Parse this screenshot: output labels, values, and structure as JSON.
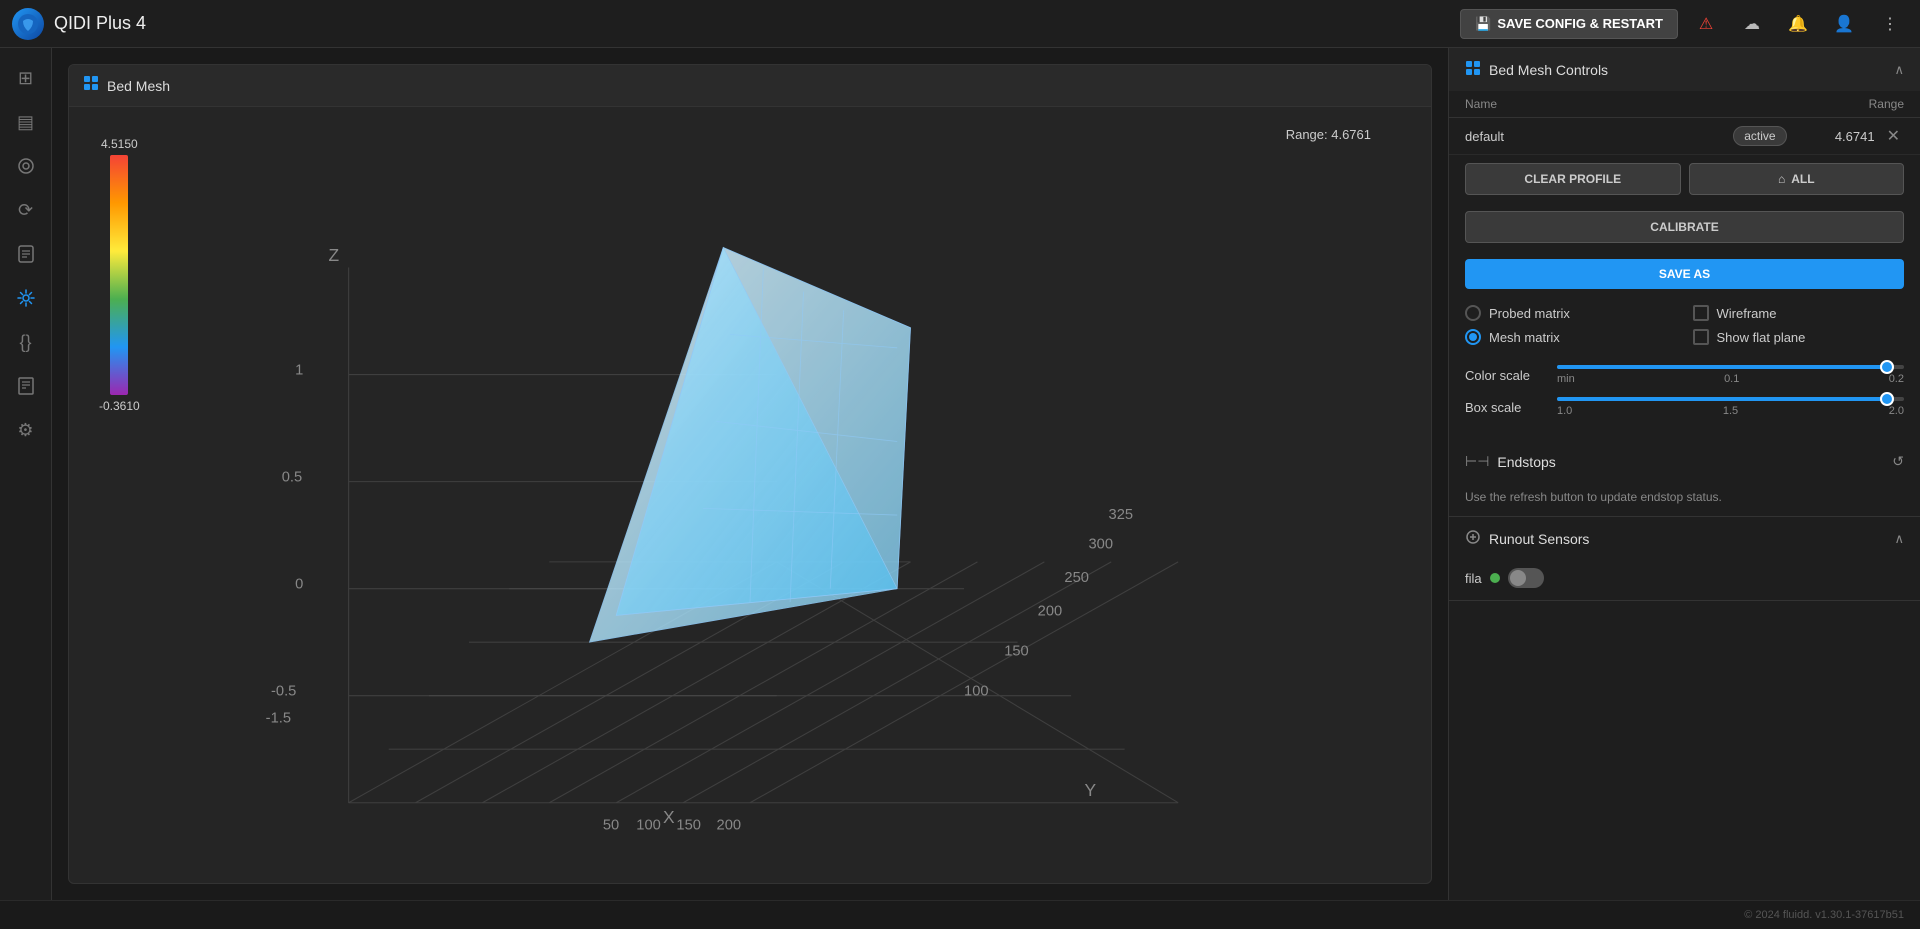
{
  "app": {
    "logo": "Q",
    "title": "QIDI Plus 4"
  },
  "topbar": {
    "save_config_label": "SAVE CONFIG & RESTART",
    "icons": [
      "alert",
      "cloud",
      "bell",
      "user",
      "more"
    ]
  },
  "sidebar": {
    "items": [
      {
        "name": "dashboard",
        "icon": "⊞",
        "active": false
      },
      {
        "name": "console",
        "icon": "▤",
        "active": false
      },
      {
        "name": "tune",
        "icon": "◎",
        "active": false
      },
      {
        "name": "history",
        "icon": "⟳",
        "active": false
      },
      {
        "name": "docs",
        "icon": "📄",
        "active": false
      },
      {
        "name": "calibrate",
        "icon": "⊹",
        "active": true
      },
      {
        "name": "code",
        "icon": "{}",
        "active": false
      },
      {
        "name": "files",
        "icon": "☰",
        "active": false
      },
      {
        "name": "settings",
        "icon": "⚙",
        "active": false
      }
    ]
  },
  "bed_mesh": {
    "panel_title": "Bed Mesh",
    "range_label": "Range: 4.6761",
    "color_scale": {
      "max": "4.5150",
      "min": "-0.3610"
    }
  },
  "controls": {
    "panel_title": "Bed Mesh Controls",
    "table": {
      "col_name": "Name",
      "col_range": "Range"
    },
    "profile": {
      "name": "default",
      "badge": "active",
      "range": "4.6741"
    },
    "buttons": {
      "clear_profile": "CLEAR PROFILE",
      "all": "ALL",
      "all_icon": "⌂",
      "calibrate": "CALIBRATE",
      "save_as": "SAVE AS"
    },
    "options": {
      "probed_matrix": "Probed matrix",
      "mesh_matrix": "Mesh matrix",
      "wireframe": "Wireframe",
      "show_flat_plane": "Show flat plane",
      "probed_checked": false,
      "mesh_checked": true,
      "wireframe_checked": false,
      "flat_plane_checked": false
    },
    "color_scale": {
      "label": "Color scale",
      "min_label": "min",
      "mid_value": "0.1",
      "max_value": "0.2",
      "fill_pct": 95
    },
    "box_scale": {
      "label": "Box scale",
      "min_value": "1.0",
      "mid_value": "1.5",
      "max_value": "2.0",
      "fill_pct": 95
    }
  },
  "endstops": {
    "title": "Endstops",
    "description": "Use the refresh button to update endstop status."
  },
  "runout_sensors": {
    "title": "Runout Sensors",
    "sensors": [
      {
        "name": "fila",
        "active": true,
        "enabled": false
      }
    ]
  },
  "footer": {
    "text": "© 2024 fluidd. v1.30.1-37617b51"
  }
}
